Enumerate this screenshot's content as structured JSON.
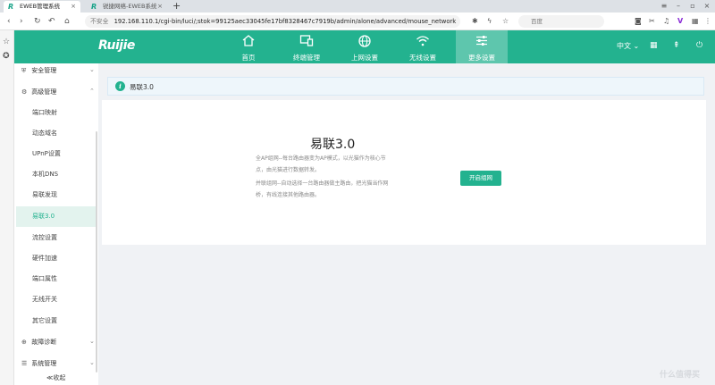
{
  "browser": {
    "tabs": [
      {
        "title": "EWEB管理系统",
        "active": true
      },
      {
        "title": "锐捷网络-EWEB系统",
        "active": false
      }
    ],
    "unsafe_label": "不安全",
    "url": "192.168.110.1/cgi-bin/luci/;stok=99125aec33045fe17bf8328467c7919b/admin/alone/advanced/mouse_network",
    "search_placeholder": "百度"
  },
  "header": {
    "logo": "Ruijie",
    "nav": [
      {
        "label": "首页",
        "icon": "home-icon"
      },
      {
        "label": "终端管理",
        "icon": "devices-icon"
      },
      {
        "label": "上网设置",
        "icon": "globe-icon"
      },
      {
        "label": "无线设置",
        "icon": "wifi-icon"
      },
      {
        "label": "更多设置",
        "icon": "sliders-icon",
        "active": true
      }
    ],
    "language": "中文"
  },
  "sidebar": {
    "sections": [
      {
        "label": "安全管理",
        "icon": "shield-icon",
        "chevron": "down"
      },
      {
        "label": "高级管理",
        "icon": "settings-icon",
        "chevron": "up"
      },
      {
        "label": "故障诊断",
        "icon": "diagnose-icon",
        "chevron": "down"
      },
      {
        "label": "系统管理",
        "icon": "system-icon",
        "chevron": "down"
      }
    ],
    "items": [
      "端口映射",
      "动态域名",
      "UPnP设置",
      "本机DNS",
      "易联发现",
      "易联3.0",
      "流控设置",
      "硬件加速",
      "端口属性",
      "无线开关",
      "其它设置"
    ],
    "active_item": "易联3.0",
    "collapse": "≪收起"
  },
  "main": {
    "info_title": "易联3.0",
    "title": "易联3.0",
    "desc_line1": "全AP组网--每台路由器变为AP模式，以光猫作为核心节",
    "desc_line2": "点，由光猫进行数据转发。",
    "desc_line3": "并联组网--自动选择一台路由器做主路由，把光猫当作网",
    "desc_line4": "桥，有线连接其他路由器。",
    "button": "开启组网"
  },
  "watermark": "什么值得买",
  "colors": {
    "accent": "#23b28f",
    "active_nav": "#5ec6ad"
  }
}
